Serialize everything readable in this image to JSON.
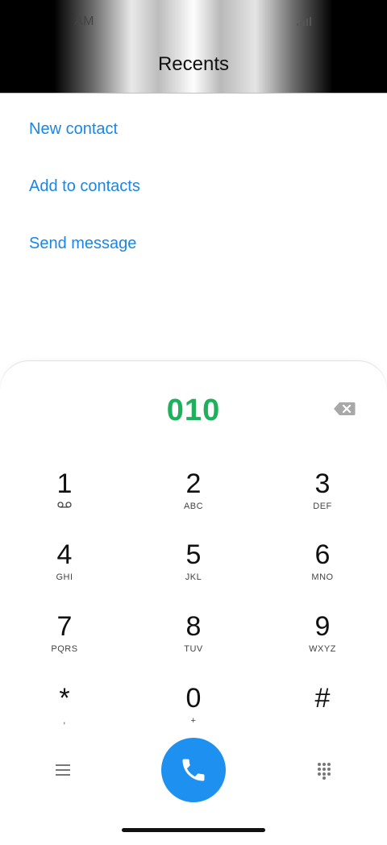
{
  "status_bar": {
    "time": "AM"
  },
  "header": {
    "title": "Recents"
  },
  "actions": {
    "new_contact": "New contact",
    "add_to_contacts": "Add to contacts",
    "send_message": "Send message"
  },
  "dialer": {
    "number": "010",
    "keys": [
      {
        "digit": "1",
        "letters": ""
      },
      {
        "digit": "2",
        "letters": "ABC"
      },
      {
        "digit": "3",
        "letters": "DEF"
      },
      {
        "digit": "4",
        "letters": "GHI"
      },
      {
        "digit": "5",
        "letters": "JKL"
      },
      {
        "digit": "6",
        "letters": "MNO"
      },
      {
        "digit": "7",
        "letters": "PQRS"
      },
      {
        "digit": "8",
        "letters": "TUV"
      },
      {
        "digit": "9",
        "letters": "WXYZ"
      },
      {
        "digit": "*",
        "letters": ","
      },
      {
        "digit": "0",
        "letters": "+"
      },
      {
        "digit": "#",
        "letters": ""
      }
    ]
  },
  "colors": {
    "accent_blue": "#1a86e5",
    "number_green": "#1eb15b",
    "call_button": "#1e90f0"
  },
  "icons": {
    "voicemail": "voicemail-icon",
    "backspace": "backspace-icon",
    "menu": "menu-icon",
    "call": "phone-icon",
    "keypad": "keypad-icon"
  }
}
